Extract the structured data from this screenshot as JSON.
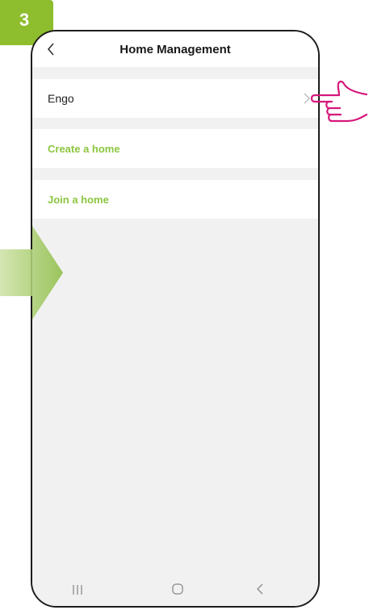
{
  "step": {
    "number": "3",
    "color": "#8ebd2d"
  },
  "header": {
    "title": "Home Management",
    "back_icon": "chevron-left-icon"
  },
  "homes": [
    {
      "label": "Engo",
      "icon": "chevron-right-icon"
    }
  ],
  "actions": {
    "create_label": "Create a home",
    "join_label": "Join a home"
  },
  "nav_bar": {
    "recents_icon": "recents-icon",
    "home_icon": "home-icon",
    "back_icon": "back-icon"
  },
  "colors": {
    "accent": "#8cc63f",
    "phone_bg": "#f1f1f1",
    "hand": "#d6177b",
    "arrow": "#9cc55a"
  }
}
